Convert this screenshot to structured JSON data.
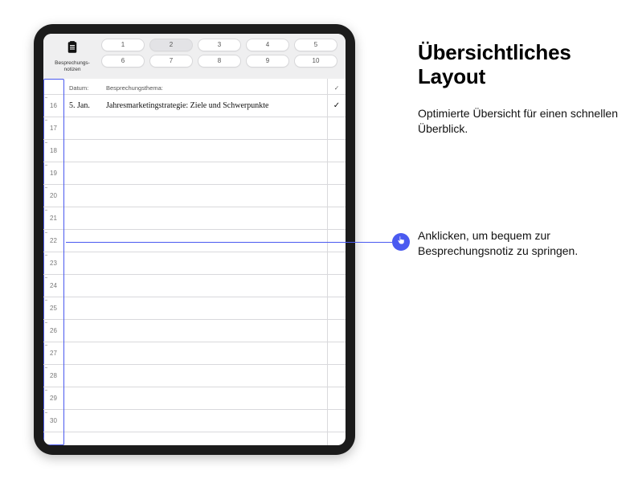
{
  "accent_color": "#4a5af0",
  "toolbar": {
    "icon_caption_line1": "Besprechungs-",
    "icon_caption_line2": "notizen",
    "pills": [
      "1",
      "2",
      "3",
      "4",
      "5",
      "6",
      "7",
      "8",
      "9",
      "10"
    ],
    "active_pill_index": 1
  },
  "headers": {
    "date": "Datum:",
    "topic": "Besprechungsthema:",
    "check": "✓"
  },
  "rows": [
    {
      "num": "16",
      "date": "5. Jan.",
      "topic": "Jahresmarketingstrategie: Ziele und Schwerpunkte",
      "checked": true
    },
    {
      "num": "17",
      "date": "",
      "topic": "",
      "checked": false
    },
    {
      "num": "18",
      "date": "",
      "topic": "",
      "checked": false
    },
    {
      "num": "19",
      "date": "",
      "topic": "",
      "checked": false
    },
    {
      "num": "20",
      "date": "",
      "topic": "",
      "checked": false
    },
    {
      "num": "21",
      "date": "",
      "topic": "",
      "checked": false
    },
    {
      "num": "22",
      "date": "",
      "topic": "",
      "checked": false
    },
    {
      "num": "23",
      "date": "",
      "topic": "",
      "checked": false
    },
    {
      "num": "24",
      "date": "",
      "topic": "",
      "checked": false
    },
    {
      "num": "25",
      "date": "",
      "topic": "",
      "checked": false
    },
    {
      "num": "26",
      "date": "",
      "topic": "",
      "checked": false
    },
    {
      "num": "27",
      "date": "",
      "topic": "",
      "checked": false
    },
    {
      "num": "28",
      "date": "",
      "topic": "",
      "checked": false
    },
    {
      "num": "29",
      "date": "",
      "topic": "",
      "checked": false
    },
    {
      "num": "30",
      "date": "",
      "topic": "",
      "checked": false
    }
  ],
  "highlighted_row_num": "23",
  "copy": {
    "heading": "Übersichtliches Layout",
    "subtitle": "Optimierte Übersicht für einen schnellen Überblick.",
    "jump_note": "Anklicken, um bequem zur Besprechungsnotiz zu springen."
  }
}
